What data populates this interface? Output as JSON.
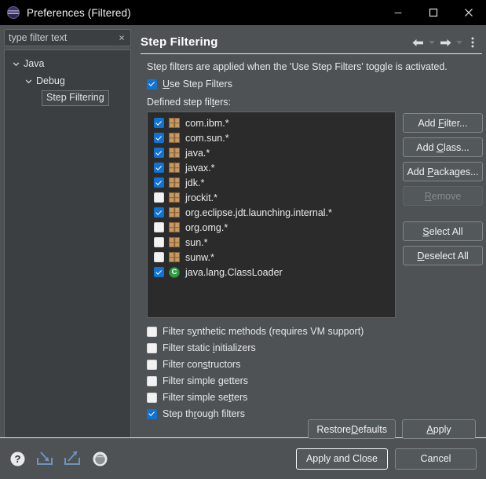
{
  "window": {
    "title": "Preferences (Filtered)",
    "app_icon": "eclipse-icon",
    "controls": {
      "minimize": "minimize-icon",
      "maximize": "maximize-icon",
      "close": "close-icon"
    }
  },
  "sidebar": {
    "filter": {
      "value": "type filter text",
      "placeholder": "type filter text",
      "clear_icon": "×"
    },
    "tree": [
      {
        "label": "Java",
        "depth": 0,
        "expanded": true,
        "twisty": "⌄",
        "selected": false
      },
      {
        "label": "Debug",
        "depth": 1,
        "expanded": true,
        "twisty": "⌄",
        "selected": false
      },
      {
        "label": "Step Filtering",
        "depth": 2,
        "expanded": null,
        "twisty": "",
        "selected": true
      }
    ]
  },
  "page": {
    "title": "Step Filtering",
    "toolbar": {
      "back": "back-arrow-icon",
      "back_menu": "chevron-down-icon",
      "forward": "forward-arrow-icon",
      "forward_menu": "chevron-down-icon",
      "view_menu": "vertical-ellipsis-icon"
    },
    "description": "Step filters are applied when the 'Use Step Filters' toggle is activated.",
    "use_step_filters": {
      "label_pre": "",
      "label_mnemonic": "U",
      "label_post": "se Step Filters",
      "checked": true
    },
    "defined_label_pre": "Defined step fil",
    "defined_label_mnemonic": "t",
    "defined_label_post": "ers:",
    "filters": [
      {
        "label": "com.ibm.*",
        "checked": true,
        "icon": "package-icon"
      },
      {
        "label": "com.sun.*",
        "checked": true,
        "icon": "package-icon"
      },
      {
        "label": "java.*",
        "checked": true,
        "icon": "package-icon"
      },
      {
        "label": "javax.*",
        "checked": true,
        "icon": "package-icon"
      },
      {
        "label": "jdk.*",
        "checked": true,
        "icon": "package-icon"
      },
      {
        "label": "jrockit.*",
        "checked": false,
        "icon": "package-icon"
      },
      {
        "label": "org.eclipse.jdt.launching.internal.*",
        "checked": true,
        "icon": "package-icon"
      },
      {
        "label": "org.omg.*",
        "checked": false,
        "icon": "package-icon"
      },
      {
        "label": "sun.*",
        "checked": false,
        "icon": "package-icon"
      },
      {
        "label": "sunw.*",
        "checked": false,
        "icon": "package-icon"
      },
      {
        "label": "java.lang.ClassLoader",
        "checked": true,
        "icon": "class-icon",
        "icon_letter": "C"
      }
    ],
    "side_buttons": [
      {
        "pre": "Add ",
        "mnemonic": "F",
        "post": "ilter...",
        "enabled": true,
        "name": "add-filter-button",
        "gap_before": false
      },
      {
        "pre": "Add ",
        "mnemonic": "C",
        "post": "lass...",
        "enabled": true,
        "name": "add-class-button",
        "gap_before": false
      },
      {
        "pre": "Add ",
        "mnemonic": "P",
        "post": "ackages...",
        "enabled": true,
        "name": "add-packages-button",
        "gap_before": false
      },
      {
        "pre": "",
        "mnemonic": "R",
        "post": "emove",
        "enabled": false,
        "name": "remove-button",
        "gap_before": false
      },
      {
        "pre": "",
        "mnemonic": "S",
        "post": "elect All",
        "enabled": true,
        "name": "select-all-button",
        "gap_before": true
      },
      {
        "pre": "",
        "mnemonic": "D",
        "post": "eselect All",
        "enabled": true,
        "name": "deselect-all-button",
        "gap_before": false
      }
    ],
    "options": [
      {
        "pre": "Filter s",
        "mnemonic": "y",
        "post": "nthetic methods (requires VM support)",
        "checked": false,
        "name": "filter-synthetic-methods-checkbox"
      },
      {
        "pre": "Filter static ",
        "mnemonic": "i",
        "post": "nitializers",
        "checked": false,
        "name": "filter-static-initializers-checkbox"
      },
      {
        "pre": "Filter con",
        "mnemonic": "s",
        "post": "tructors",
        "checked": false,
        "name": "filter-constructors-checkbox"
      },
      {
        "pre": "Filter simple ",
        "mnemonic": "g",
        "post": "etters",
        "checked": false,
        "name": "filter-simple-getters-checkbox"
      },
      {
        "pre": "Filter simple se",
        "mnemonic": "t",
        "post": "ters",
        "checked": false,
        "name": "filter-simple-setters-checkbox"
      },
      {
        "pre": "Step th",
        "mnemonic": "r",
        "post": "ough filters",
        "checked": true,
        "name": "step-through-filters-checkbox"
      }
    ],
    "actions": {
      "restore_pre": "Restore ",
      "restore_mnemonic": "D",
      "restore_post": "efaults",
      "apply_pre": "",
      "apply_mnemonic": "A",
      "apply_post": "pply"
    }
  },
  "footer": {
    "icons": [
      {
        "name": "help-icon",
        "title": "?"
      },
      {
        "name": "import-icon",
        "title": "import"
      },
      {
        "name": "export-icon",
        "title": "export"
      },
      {
        "name": "globe-icon",
        "title": "globe"
      }
    ],
    "apply_and_close": "Apply and Close",
    "cancel": "Cancel"
  },
  "colors": {
    "window_bg": "#4e5254",
    "titlebar_bg": "#000000",
    "field_bg": "#3b3f41",
    "list_bg": "#2b2b2b",
    "accent_blue": "#1272d2",
    "class_green": "#2f9e44",
    "package_tan": "#c79a63",
    "text": "#e6e8e9",
    "disabled_text": "#878c8e"
  }
}
